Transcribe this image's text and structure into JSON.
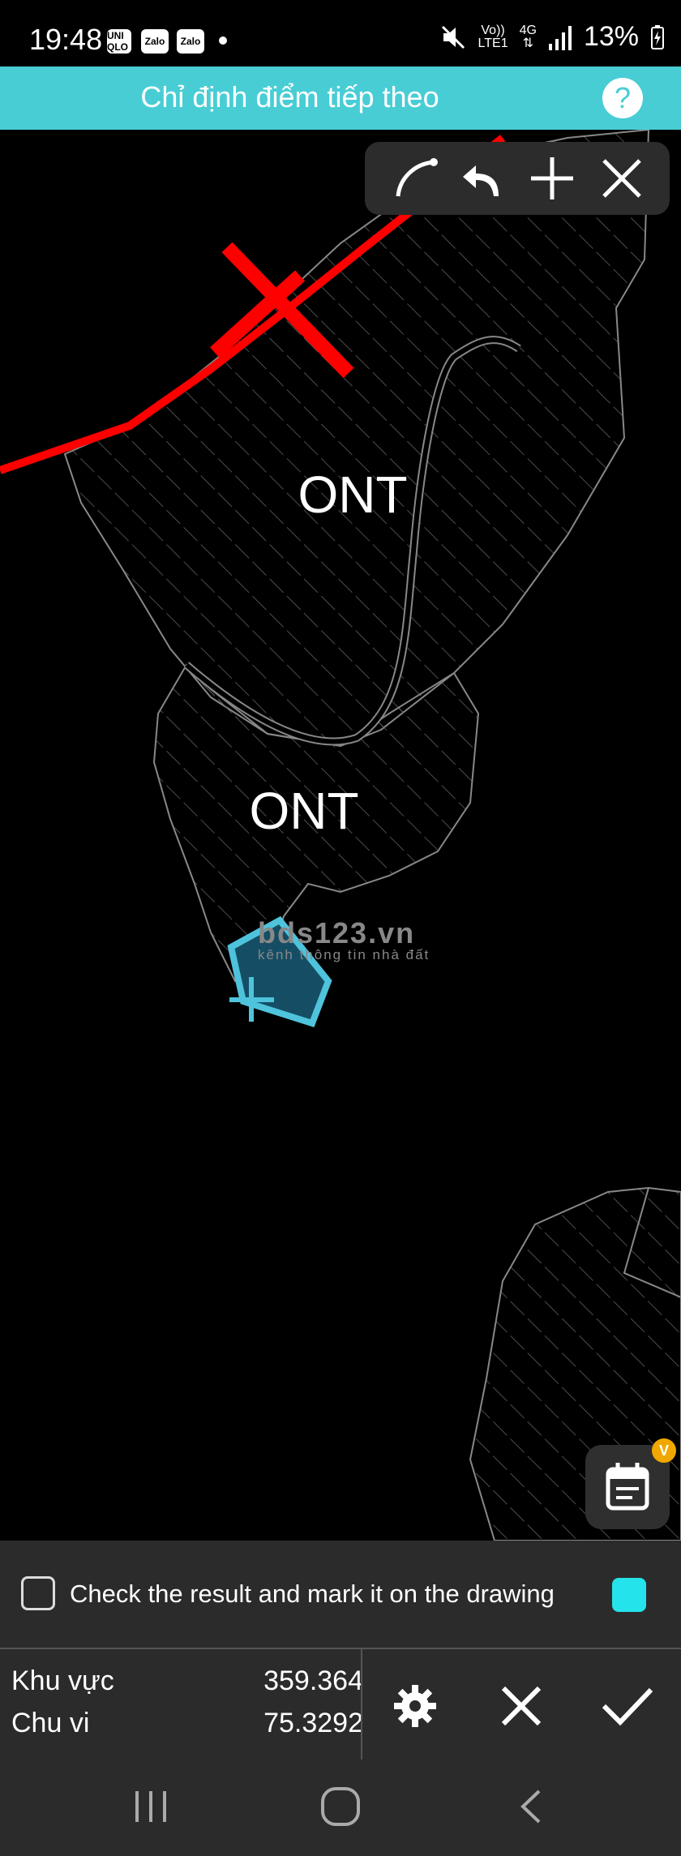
{
  "status_bar": {
    "time": "19:48",
    "apps": [
      "UNI QLO",
      "Zalo",
      "Zalo"
    ],
    "network_top": "Vo))",
    "network_bottom": "LTE1",
    "net_gen": "4G",
    "battery": "13%"
  },
  "header": {
    "title": "Chỉ định điểm tiếp theo",
    "help": "?"
  },
  "map": {
    "labels": [
      "ONT",
      "ONT"
    ],
    "watermark": {
      "main": "bds123.vn",
      "sub": "kênh thông tin nhà đất"
    },
    "selection_color": "#4fc3dc",
    "road_color": "#ff0000"
  },
  "toolbar": {
    "tools": [
      "arc-icon",
      "undo-icon",
      "plus-icon",
      "close-icon"
    ]
  },
  "calendar_button": {
    "badge": "V"
  },
  "check_panel": {
    "label": "Check the result and mark it on the drawing",
    "checked": false,
    "color": "#25e3ea"
  },
  "results": {
    "area_label": "Khu vực",
    "area_value": "359.364",
    "perimeter_label": "Chu vi",
    "perimeter_value": "75.3292"
  },
  "actions": [
    "gear-icon",
    "close-icon",
    "check-icon"
  ],
  "nav": [
    "recent-apps-icon",
    "home-icon",
    "back-icon"
  ]
}
